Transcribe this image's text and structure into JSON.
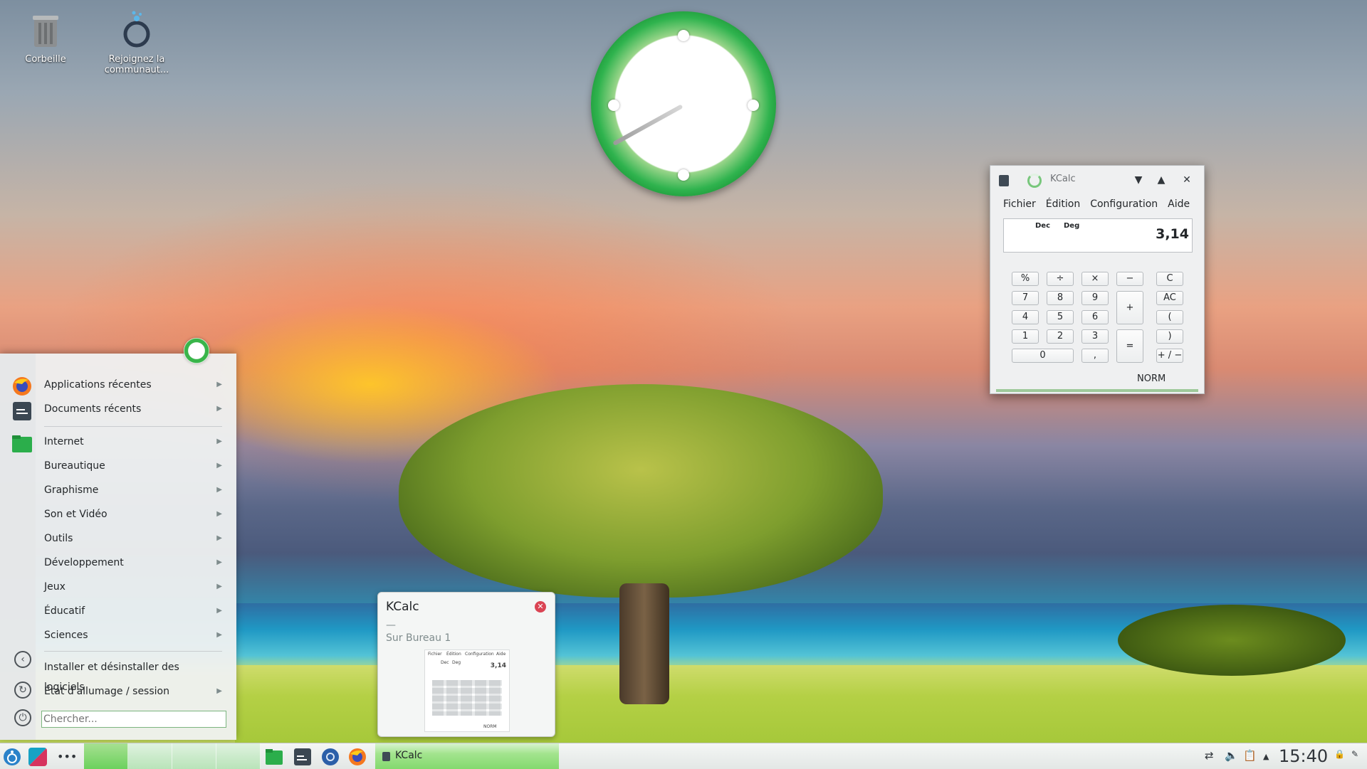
{
  "desktop": {
    "icons": [
      {
        "label": "Corbeille"
      },
      {
        "label": "Rejoignez la communaut..."
      }
    ]
  },
  "kcalc": {
    "title": "KCalc",
    "menu": [
      "Fichier",
      "Édition",
      "Configuration",
      "Aide"
    ],
    "flags": [
      "Dec",
      "Deg"
    ],
    "display_value": "3,14",
    "status": "NORM",
    "buttons": {
      "percent": "%",
      "divide": "÷",
      "multiply": "×",
      "minus": "−",
      "clear": "C",
      "allclear": "AC",
      "seven": "7",
      "eight": "8",
      "nine": "9",
      "four": "4",
      "five": "5",
      "six": "6",
      "one": "1",
      "two": "2",
      "three": "3",
      "zero": "0",
      "decimal": ",",
      "plus": "+",
      "equals": "=",
      "open_paren": "(",
      "close_paren": ")",
      "plus_minus": "+ / −"
    }
  },
  "start_menu": {
    "items": [
      {
        "label": "Applications récentes"
      },
      {
        "label": "Documents récents"
      },
      {
        "label": "Internet"
      },
      {
        "label": "Bureautique"
      },
      {
        "label": "Graphisme"
      },
      {
        "label": "Son et Vidéo"
      },
      {
        "label": "Outils"
      },
      {
        "label": "Développement"
      },
      {
        "label": "Jeux"
      },
      {
        "label": "Éducatif"
      },
      {
        "label": "Sciences"
      }
    ],
    "system": [
      {
        "label": "Installer et désinstaller des logiciels"
      },
      {
        "label": "État d'allumage / session"
      }
    ],
    "search_placeholder": "Chercher..."
  },
  "tooltip": {
    "title": "KCalc",
    "dash": "—",
    "desktop": "Sur Bureau 1",
    "thumb_menu": [
      "Fichier",
      "Édition",
      "Configuration",
      "Aide"
    ],
    "thumb_flags": [
      "Dec",
      "Deg"
    ],
    "thumb_value": "3,14",
    "thumb_status": "NORM"
  },
  "taskbar": {
    "task_label": "KCalc",
    "time": "15:40",
    "launchers": [
      "application-menu-icon",
      "desktop-icon",
      "more-icon",
      "file-manager-icon",
      "terminal-icon",
      "settings-icon",
      "firefox-icon"
    ]
  },
  "colors": {
    "accent": "#39b54a",
    "close": "#da4453"
  }
}
